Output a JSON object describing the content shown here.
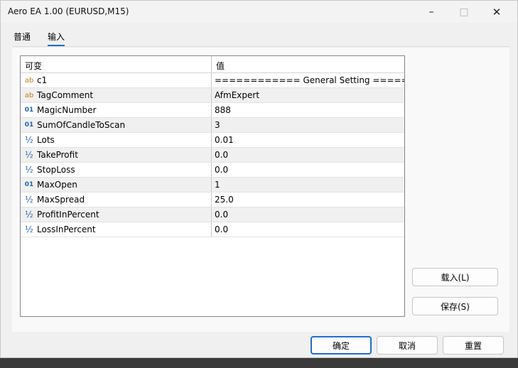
{
  "window": {
    "title": "Aero EA 1.00 (EURUSD,M15)"
  },
  "tabs": [
    {
      "label": "普通",
      "active": false
    },
    {
      "label": "输入",
      "active": true
    }
  ],
  "grid": {
    "headers": {
      "variable": "可变",
      "value": "值"
    },
    "rows": [
      {
        "type": "ab",
        "name": "c1",
        "value": "============ General Setting =====..."
      },
      {
        "type": "ab",
        "name": "TagComment",
        "value": "AfmExpert"
      },
      {
        "type": "01",
        "name": "MagicNumber",
        "value": "888"
      },
      {
        "type": "01",
        "name": "SumOfCandleToScan",
        "value": "3"
      },
      {
        "type": "½",
        "name": "Lots",
        "value": "0.01"
      },
      {
        "type": "½",
        "name": "TakeProfit",
        "value": "0.0"
      },
      {
        "type": "½",
        "name": "StopLoss",
        "value": "0.0"
      },
      {
        "type": "01",
        "name": "MaxOpen",
        "value": "1"
      },
      {
        "type": "½",
        "name": "MaxSpread",
        "value": "25.0"
      },
      {
        "type": "½",
        "name": "ProfitInPercent",
        "value": "0.0"
      },
      {
        "type": "½",
        "name": "LossInPercent",
        "value": "0.0"
      }
    ]
  },
  "buttons": {
    "load": "载入(L)",
    "save": "保存(S)",
    "ok": "确定",
    "cancel": "取消",
    "reset": "重置"
  },
  "colors": {
    "accent": "#1e6fcf",
    "string_icon": "#c77a10",
    "number_icon": "#1f63b8"
  }
}
